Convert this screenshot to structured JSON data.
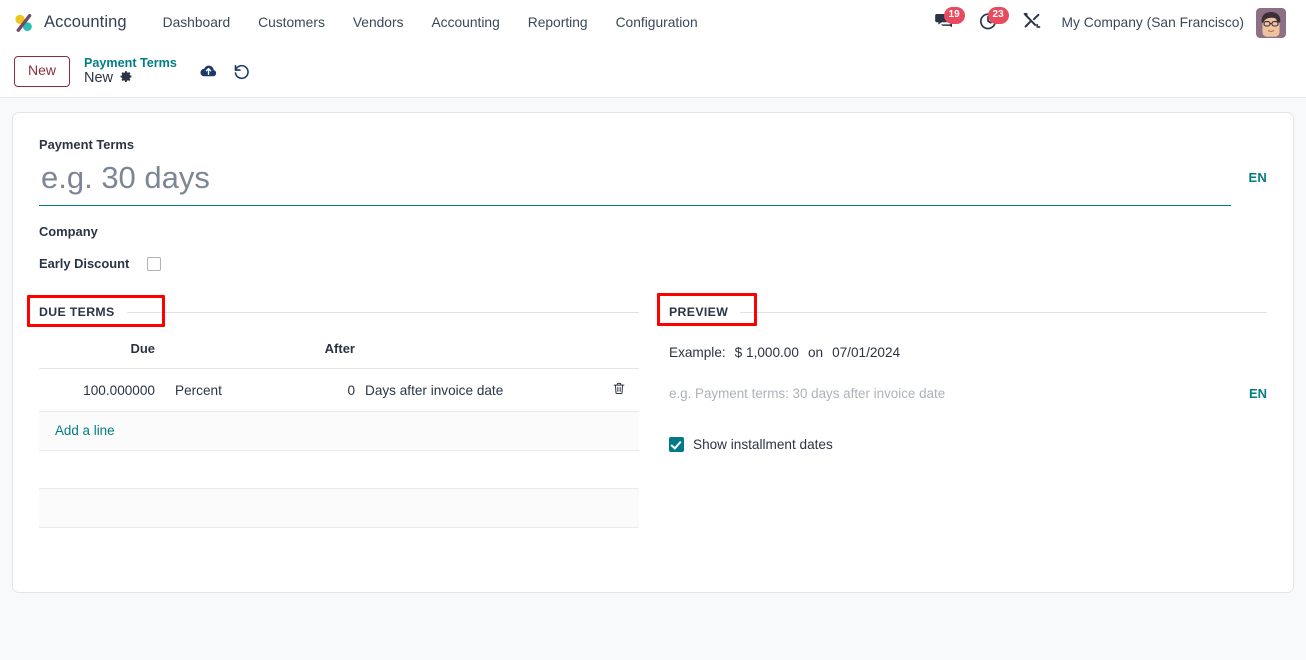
{
  "navbar": {
    "brand": "Accounting",
    "logo_icon": "odoo-logo-icon",
    "menu": [
      {
        "label": "Dashboard"
      },
      {
        "label": "Customers"
      },
      {
        "label": "Vendors"
      },
      {
        "label": "Accounting"
      },
      {
        "label": "Reporting"
      },
      {
        "label": "Configuration"
      }
    ],
    "messages_icon": "speech-bubble-icon",
    "messages_count": "19",
    "activities_icon": "clock-activity-icon",
    "activities_count": "23",
    "debug_icon": "wrench-tools-icon",
    "company": "My Company (San Francisco)",
    "avatar_icon": "user-avatar"
  },
  "control_panel": {
    "new_label": "New",
    "breadcrumb_parent": "Payment Terms",
    "breadcrumb_current": "New",
    "gear_icon": "gear-icon",
    "save_icon": "cloud-upload-icon",
    "discard_icon": "discard-undo-icon"
  },
  "form": {
    "payment_terms_label": "Payment Terms",
    "payment_terms_value": "",
    "payment_terms_placeholder": "e.g. 30 days",
    "name_lang_badge": "EN",
    "company_label": "Company",
    "company_value": "",
    "early_discount_label": "Early Discount",
    "early_discount_checked": false
  },
  "due_terms": {
    "section_title": "DUE TERMS",
    "columns": {
      "due": "Due",
      "unit": "",
      "after": "After",
      "basis": "",
      "actions": ""
    },
    "rows": [
      {
        "due": "100.000000",
        "unit": "Percent",
        "after": "0",
        "basis": "Days after invoice date",
        "delete_icon": "trash-icon"
      }
    ],
    "add_line_label": "Add a line"
  },
  "preview": {
    "section_title": "PREVIEW",
    "example_label": "Example:",
    "example_amount": "$ 1,000.00",
    "example_on": "on",
    "example_date": "07/01/2024",
    "note_placeholder": "e.g. Payment terms: 30 days after invoice date",
    "note_value": "",
    "note_lang_badge": "EN",
    "show_installment_label": "Show installment dates",
    "show_installment_checked": true
  },
  "highlights": [
    {
      "target": "DUE TERMS",
      "color": "#fe0000"
    },
    {
      "target": "PREVIEW",
      "color": "#fe0000"
    }
  ],
  "colors": {
    "accent_teal": "#017e84",
    "brand_purple": "#714b67",
    "badge_red": "#e84b5d",
    "highlight_red": "#fe0000",
    "new_button_border": "#8b2f3f"
  }
}
